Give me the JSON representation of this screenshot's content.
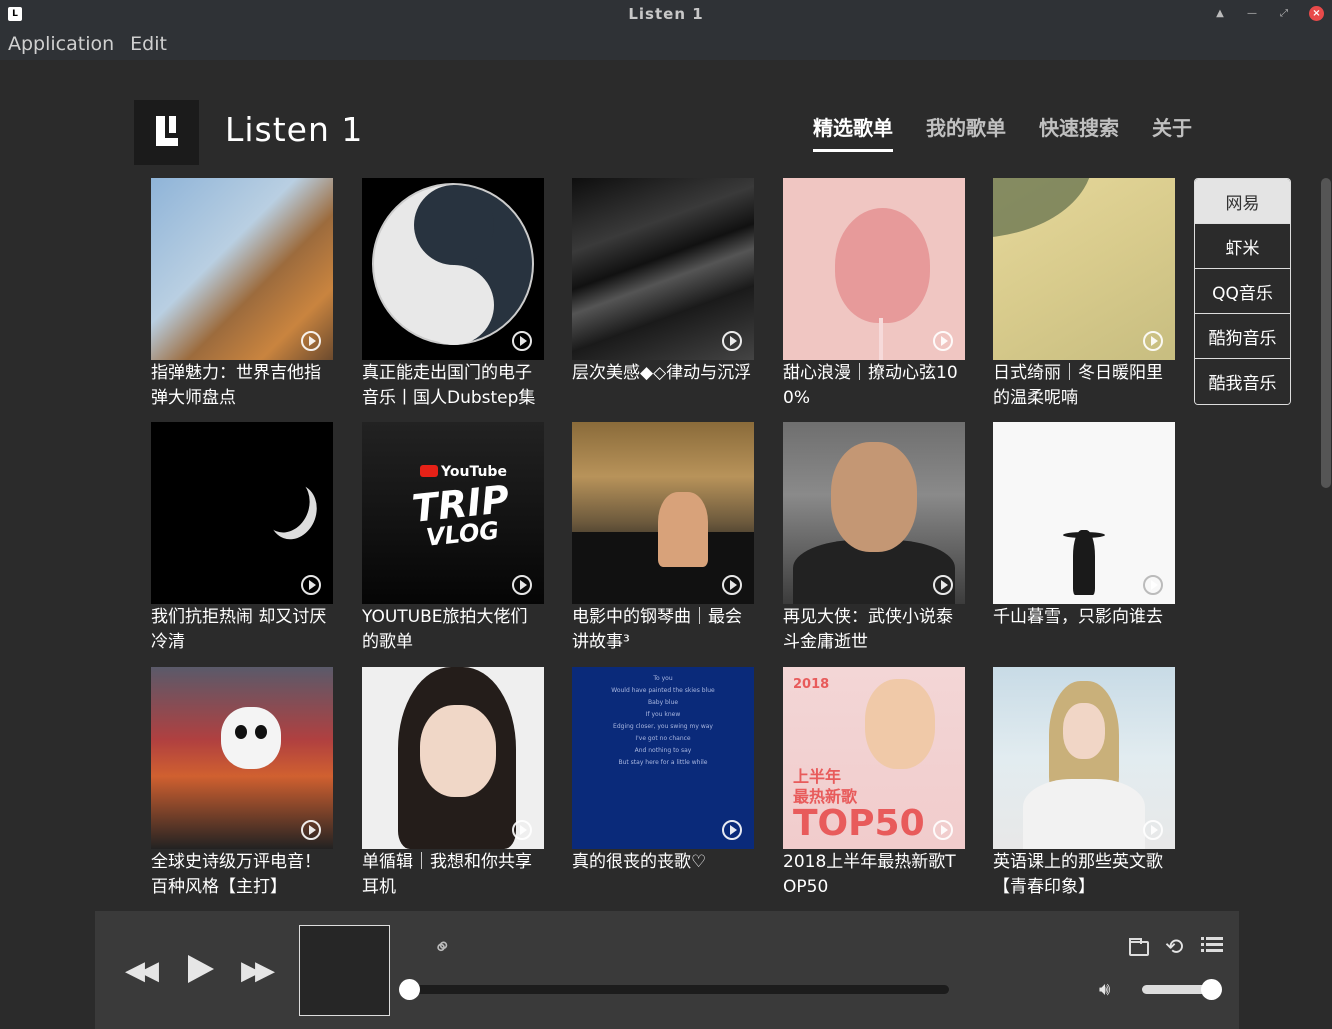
{
  "window": {
    "title": "Listen 1"
  },
  "menu": [
    "Application",
    "Edit"
  ],
  "header": {
    "app_title": "Listen 1"
  },
  "nav_tabs": [
    {
      "label": "精选歌单",
      "active": true
    },
    {
      "label": "我的歌单",
      "active": false
    },
    {
      "label": "快速搜索",
      "active": false
    },
    {
      "label": "关于",
      "active": false
    }
  ],
  "sources": [
    {
      "label": "网易",
      "active": true
    },
    {
      "label": "虾米",
      "active": false
    },
    {
      "label": "QQ音乐",
      "active": false
    },
    {
      "label": "酷狗音乐",
      "active": false
    },
    {
      "label": "酷我音乐",
      "active": false
    }
  ],
  "playlists": [
    {
      "title": "指弹魅力：世界吉他指弹大师盘点",
      "cover": "guitarist"
    },
    {
      "title": "真正能走出国门的电子音乐丨国人Dubstep集",
      "cover": "yin-yang-skull"
    },
    {
      "title": "层次美感◆◇律动与沉浮",
      "cover": "sand-dunes"
    },
    {
      "title": "甜心浪漫｜撩动心弦100%",
      "cover": "cotton-candy"
    },
    {
      "title": "日式绮丽｜冬日暖阳里的温柔呢喃",
      "cover": "meadow"
    },
    {
      "title": "我们抗拒热闹 却又讨厌冷清",
      "cover": "moon"
    },
    {
      "title": "YOUTUBE旅拍大佬们的歌单",
      "cover": "youtube-trip-vlog"
    },
    {
      "title": "电影中的钢琴曲｜最会讲故事³",
      "cover": "piano-scene"
    },
    {
      "title": "再见大侠：武侠小说泰斗金庸逝世",
      "cover": "portrait-elder"
    },
    {
      "title": "千山暮雪，只影向谁去",
      "cover": "lone-figure"
    },
    {
      "title": "全球史诗级万评电音！百种风格【主打】",
      "cover": "marshmello"
    },
    {
      "title": "单循辑｜我想和你共享耳机",
      "cover": "girl-portrait"
    },
    {
      "title": "真的很丧的丧歌♡",
      "cover": "blue-lyrics"
    },
    {
      "title": "2018上半年最热新歌TOP50",
      "cover": "top50"
    },
    {
      "title": "英语课上的那些英文歌【青春印象】",
      "cover": "avril"
    }
  ],
  "covers_text": {
    "yt": "YouTube",
    "trip": "TRIP",
    "vlog": "VLOG",
    "lyrics": [
      "To you",
      "Would have painted the skies blue",
      "Baby blue",
      "If you knew",
      "Edging closer, you swing my way",
      "I've got no chance",
      "And nothing to say",
      "But stay here for a little while"
    ],
    "top_year": "2018",
    "top_line1": "上半年",
    "top_line2": "最热新歌",
    "top_line3": "TOP50"
  },
  "player": {
    "progress": 0,
    "volume": 1.0
  },
  "icons": [
    "app-icon",
    "prev-icon",
    "play-icon",
    "next-icon",
    "link-icon",
    "folder-icon",
    "repeat-icon",
    "playlist-icon",
    "volume-icon"
  ]
}
